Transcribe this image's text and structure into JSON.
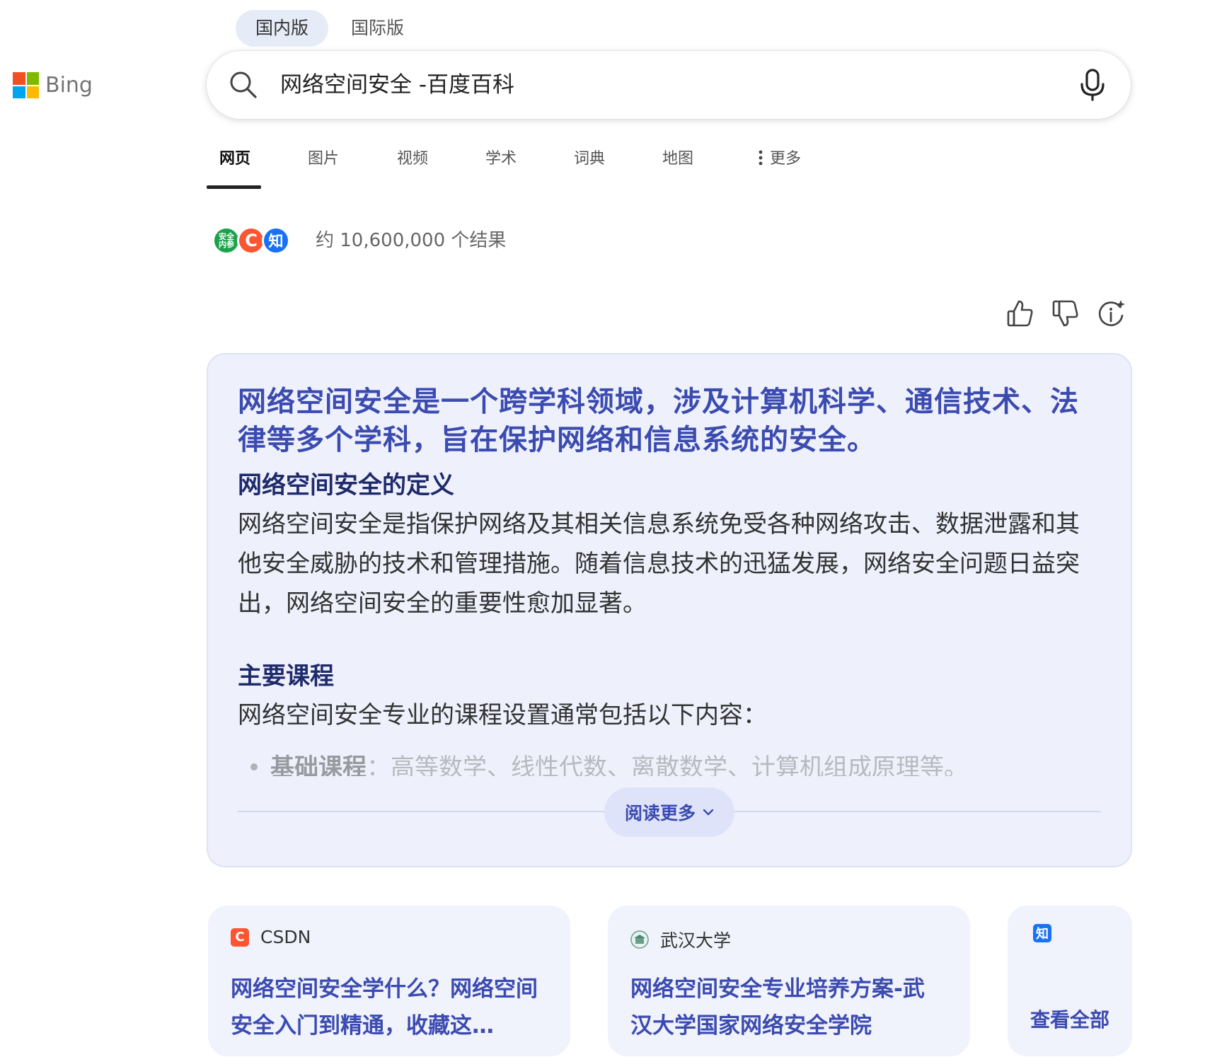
{
  "logo": {
    "text": "Bing"
  },
  "market": {
    "items": [
      "国内版",
      "国际版"
    ],
    "active": 0
  },
  "search": {
    "query": "网络空间安全 -百度百科"
  },
  "nav": {
    "items": [
      "网页",
      "图片",
      "视频",
      "学术",
      "词典",
      "地图"
    ],
    "active": 0,
    "more_label": "更多"
  },
  "results": {
    "source_icons": [
      {
        "name": "安全内参",
        "glyph": "安全内参"
      },
      {
        "name": "CSDN",
        "glyph": "C"
      },
      {
        "name": "知乎",
        "glyph": "知"
      }
    ],
    "count_text": "约 10,600,000 个结果"
  },
  "answer": {
    "headline": "网络空间安全是一个跨学科领域，涉及计算机科学、通信技术、法律等多个学科，旨在保护网络和信息系统的安全。",
    "section1_title": "网络空间安全的定义",
    "section1_body": "网络空间安全是指保护网络及其相关信息系统免受各种网络攻击、数据泄露和其他安全威胁的技术和管理措施。随着信息技术的迅猛发展，网络安全问题日益突出，网络空间安全的重要性愈加显著。",
    "section2_title": "主要课程",
    "section2_body": "网络空间安全专业的课程设置通常包括以下内容：",
    "faded_item_label": "基础课程",
    "faded_item_text": "：高等数学、线性代数、离散数学、计算机组成原理等。",
    "read_more": "阅读更多"
  },
  "cards": [
    {
      "source": "CSDN",
      "title": "网络空间安全学什么？网络空间安全入门到精通，收藏这…"
    },
    {
      "source": "武汉大学",
      "title": "网络空间安全专业培养方案-武汉大学国家网络安全学院"
    },
    {
      "source_glyph": "知",
      "see_all": "查看全部"
    }
  ],
  "colors": {
    "accent": "#3b4bb0",
    "answer_bg": "#eef1fc",
    "csdn": "#fc5531",
    "zhihu": "#1772f6",
    "green_source": "#1aa34a"
  }
}
